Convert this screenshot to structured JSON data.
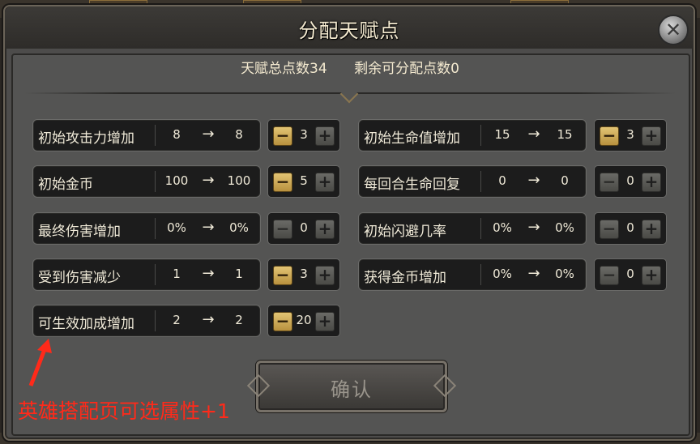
{
  "dialog": {
    "title": "分配天赋点",
    "total_points_label": "天赋总点数34",
    "remaining_points_label": "剩余可分配点数0",
    "confirm_label": "确认"
  },
  "colors": {
    "active_minus": "#d4b25e",
    "inactive_button": "#5a5a56",
    "annotation": "#ff2a1a"
  },
  "icons": {
    "close": "close-icon",
    "arrow": "arrow-right-icon",
    "minus": "minus-icon",
    "plus": "plus-icon"
  },
  "talents": [
    {
      "label": "初始攻击力增加",
      "from": "8",
      "to": "8",
      "points": "3",
      "minus_active": true
    },
    {
      "label": "初始生命值增加",
      "from": "15",
      "to": "15",
      "points": "3",
      "minus_active": true
    },
    {
      "label": "初始金币",
      "from": "100",
      "to": "100",
      "points": "5",
      "minus_active": true
    },
    {
      "label": "每回合生命回复",
      "from": "0",
      "to": "0",
      "points": "0",
      "minus_active": false
    },
    {
      "label": "最终伤害增加",
      "from": "0%",
      "to": "0%",
      "points": "0",
      "minus_active": false
    },
    {
      "label": "初始闪避几率",
      "from": "0%",
      "to": "0%",
      "points": "0",
      "minus_active": false
    },
    {
      "label": "受到伤害减少",
      "from": "1",
      "to": "1",
      "points": "3",
      "minus_active": true
    },
    {
      "label": "获得金币增加",
      "from": "0%",
      "to": "0%",
      "points": "0",
      "minus_active": false
    },
    {
      "label": "可生效加成增加",
      "from": "2",
      "to": "2",
      "points": "20",
      "minus_active": true
    }
  ],
  "arrow_symbol": "→",
  "minus_symbol": "−",
  "plus_symbol": "+",
  "close_symbol": "✕",
  "annotation": "英雄搭配页可选属性+1"
}
